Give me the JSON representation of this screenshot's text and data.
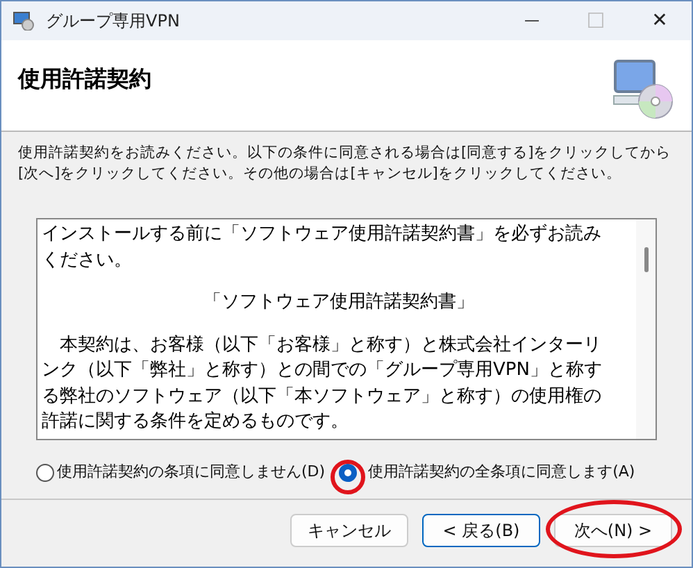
{
  "window": {
    "title": "グループ専用VPN",
    "controls": [
      {
        "kind": "minimize",
        "label": "—",
        "disabled": false
      },
      {
        "kind": "maximize",
        "label": "☐",
        "disabled": true
      },
      {
        "kind": "close",
        "label": "✕",
        "disabled": false
      }
    ]
  },
  "header": {
    "title": "使用許諾契約"
  },
  "instructions": "使用許諾契約をお読みください。以下の条件に同意される場合は[同意する]をクリックしてから[次へ]をクリックしてください。その他の場合は[キャンセル]をクリックしてください。",
  "license_text": [
    {
      "kind": "line",
      "text": "インストールする前に「ソフトウェア使用許諾契約書」を必ずお読み"
    },
    {
      "kind": "line",
      "text": "ください。"
    },
    {
      "kind": "heading",
      "text": "「ソフトウェア使用許諾契約書」"
    },
    {
      "kind": "line",
      "text": "　本契約は、お客様（以下「お客様」と称す）と株式会社インターリ"
    },
    {
      "kind": "line",
      "text": "ンク（以下「弊社」と称す）との間での「グループ専用VPN」と称す"
    },
    {
      "kind": "line",
      "text": "る弊社のソフトウェア（以下「本ソフトウェア」と称す）の使用権の"
    },
    {
      "kind": "line",
      "text": "許諾に関する条件を定めるものです。"
    }
  ],
  "options": [
    {
      "label": "使用許諾契約の条項に同意しません(D)",
      "selected": false,
      "circled": false
    },
    {
      "label": "使用許諾契約の全条項に同意します(A)",
      "selected": true,
      "circled": true
    }
  ],
  "buttons": [
    {
      "label": "キャンセル",
      "focused": false,
      "circled": false
    },
    {
      "label": "< 戻る(B)",
      "focused": true,
      "circled": false
    },
    {
      "label": "次へ(N) >",
      "focused": false,
      "circled": true
    }
  ]
}
